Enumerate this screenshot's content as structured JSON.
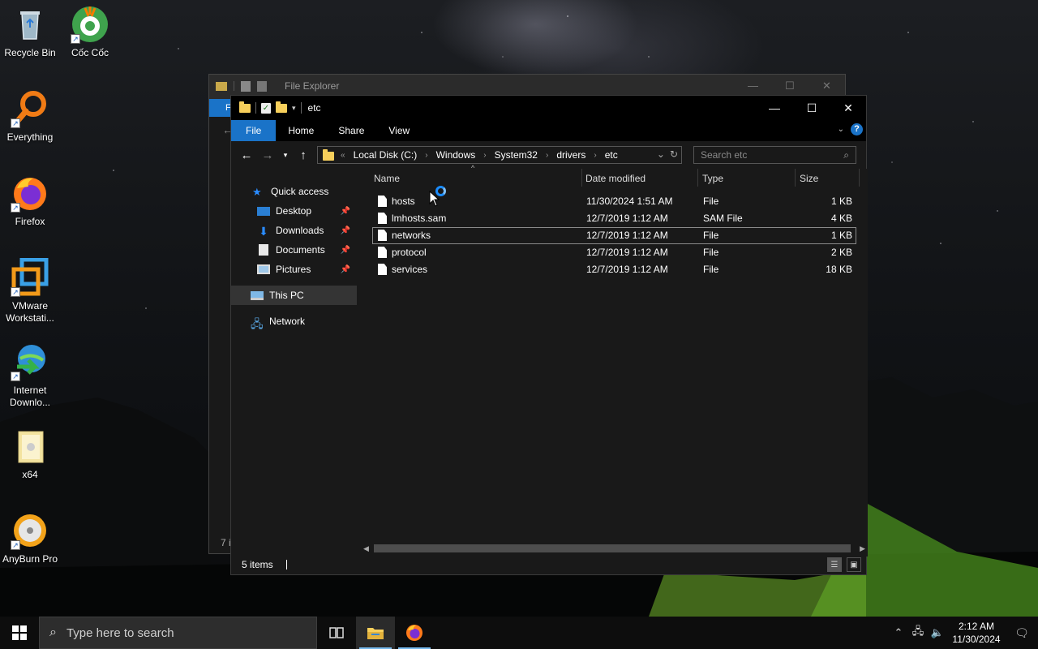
{
  "desktop": {
    "icons": [
      {
        "label": "Recycle Bin",
        "icon": "recycle-bin-icon"
      },
      {
        "label": "Cốc Cốc",
        "icon": "coccoc-browser-icon"
      },
      {
        "label": "Everything",
        "icon": "everything-search-icon"
      },
      {
        "label": "Firefox",
        "icon": "firefox-icon"
      },
      {
        "label": "VMware Workstati...",
        "icon": "vmware-icon"
      },
      {
        "label": "Internet Downlo...",
        "icon": "idm-icon"
      },
      {
        "label": "x64",
        "icon": "folder-icon"
      },
      {
        "label": "AnyBurn Pro",
        "icon": "anyburn-icon"
      }
    ]
  },
  "background_window": {
    "title": "File Explorer",
    "ribbon_stub": "F",
    "status_stub": "7 i"
  },
  "window": {
    "title": "etc",
    "controls": {
      "minimize": "—",
      "maximize": "☐",
      "close": "✕"
    },
    "ribbon_tabs": [
      "File",
      "Home",
      "Share",
      "View"
    ],
    "address": {
      "overflow": "«",
      "crumbs": [
        "Local Disk (C:)",
        "Windows",
        "System32",
        "drivers",
        "etc"
      ]
    },
    "search": {
      "placeholder": "Search etc"
    },
    "nav_pane": {
      "quick_access": "Quick access",
      "items": [
        {
          "label": "Desktop",
          "pinned": true
        },
        {
          "label": "Downloads",
          "pinned": true
        },
        {
          "label": "Documents",
          "pinned": true
        },
        {
          "label": "Pictures",
          "pinned": true
        }
      ],
      "this_pc": "This PC",
      "network": "Network"
    },
    "columns": [
      "Name",
      "Date modified",
      "Type",
      "Size"
    ],
    "files": [
      {
        "name": "hosts",
        "date": "11/30/2024 1:51 AM",
        "type": "File",
        "size": "1 KB"
      },
      {
        "name": "lmhosts.sam",
        "date": "12/7/2019 1:12 AM",
        "type": "SAM File",
        "size": "4 KB"
      },
      {
        "name": "networks",
        "date": "12/7/2019 1:12 AM",
        "type": "File",
        "size": "1 KB"
      },
      {
        "name": "protocol",
        "date": "12/7/2019 1:12 AM",
        "type": "File",
        "size": "2 KB"
      },
      {
        "name": "services",
        "date": "12/7/2019 1:12 AM",
        "type": "File",
        "size": "18 KB"
      }
    ],
    "status": {
      "item_count": "5 items"
    }
  },
  "taskbar": {
    "search_placeholder": "Type here to search",
    "clock": {
      "time": "2:12 AM",
      "date": "11/30/2024"
    }
  },
  "colors": {
    "accent": "#1a73c8",
    "window_bg": "#191919",
    "titlebar_bg": "#000000",
    "folder_yellow": "#f7cf5b"
  }
}
